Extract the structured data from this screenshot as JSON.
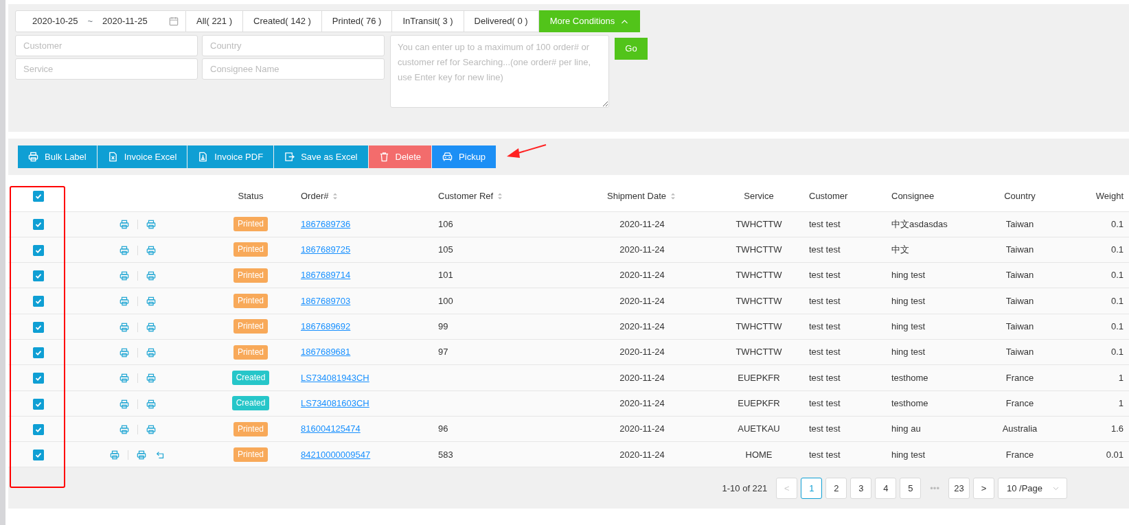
{
  "filters": {
    "date_from": "2020-10-25",
    "date_separator": "~",
    "date_to": "2020-11-25",
    "status_tabs": [
      {
        "label": "All( 221 )",
        "selected": false
      },
      {
        "label": "Created( 142 )",
        "selected": false
      },
      {
        "label": "Printed( 76 )",
        "selected": false
      },
      {
        "label": "InTransit( 3 )",
        "selected": false
      },
      {
        "label": "Delivered( 0 )",
        "selected": false
      }
    ],
    "more_conditions": {
      "label": "More Conditions",
      "expanded": true
    },
    "fields": [
      {
        "placeholder": "Customer"
      },
      {
        "placeholder": "Country"
      },
      {
        "placeholder": "Service"
      },
      {
        "placeholder": "Consignee Name"
      }
    ],
    "search_box": {
      "placeholder": "You can enter up to a maximum of 100 order# or customer ref for Searching...(one order# per line, use Enter key for new line)"
    },
    "go_button": "Go"
  },
  "toolbar": [
    {
      "label": "Bulk Label",
      "kind": "print"
    },
    {
      "label": "Invoice Excel",
      "kind": "excel"
    },
    {
      "label": "Invoice PDF",
      "kind": "pdf"
    },
    {
      "label": "Save as Excel",
      "kind": "export"
    },
    {
      "label": "Delete",
      "kind": "delete"
    },
    {
      "label": "Pickup",
      "kind": "pickup"
    }
  ],
  "table": {
    "select_all": {
      "checked": true
    },
    "columns": [
      {
        "label": "Status",
        "sortable": false
      },
      {
        "label": "Order#",
        "sortable": true
      },
      {
        "label": "Customer Ref",
        "sortable": true
      },
      {
        "label": "Shipment Date",
        "sortable": true
      },
      {
        "label": "Service",
        "sortable": false
      },
      {
        "label": "Customer",
        "sortable": false
      },
      {
        "label": "Consignee",
        "sortable": false
      },
      {
        "label": "Country",
        "sortable": false
      },
      {
        "label": "Weight",
        "sortable": false
      }
    ],
    "rows": [
      {
        "checked": true,
        "returnable": false,
        "status": "Printed",
        "color": "#f8a959",
        "order": "1867689736",
        "ref": "106",
        "date": "2020-11-24",
        "service": "TWHCTTW",
        "customer": "test test",
        "consignee": "中文asdasdas",
        "country": "Taiwan",
        "weight": "0.1"
      },
      {
        "checked": true,
        "returnable": false,
        "status": "Printed",
        "color": "#f8a959",
        "order": "1867689725",
        "ref": "105",
        "date": "2020-11-24",
        "service": "TWHCTTW",
        "customer": "test test",
        "consignee": "中文",
        "country": "Taiwan",
        "weight": "0.1"
      },
      {
        "checked": true,
        "returnable": false,
        "status": "Printed",
        "color": "#f8a959",
        "order": "1867689714",
        "ref": "101",
        "date": "2020-11-24",
        "service": "TWHCTTW",
        "customer": "test test",
        "consignee": "hing test",
        "country": "Taiwan",
        "weight": "0.1"
      },
      {
        "checked": true,
        "returnable": false,
        "status": "Printed",
        "color": "#f8a959",
        "order": "1867689703",
        "ref": "100",
        "date": "2020-11-24",
        "service": "TWHCTTW",
        "customer": "test test",
        "consignee": "hing test",
        "country": "Taiwan",
        "weight": "0.1"
      },
      {
        "checked": true,
        "returnable": false,
        "status": "Printed",
        "color": "#f8a959",
        "order": "1867689692",
        "ref": "99",
        "date": "2020-11-24",
        "service": "TWHCTTW",
        "customer": "test test",
        "consignee": "hing test",
        "country": "Taiwan",
        "weight": "0.1"
      },
      {
        "checked": true,
        "returnable": false,
        "status": "Printed",
        "color": "#f8a959",
        "order": "1867689681",
        "ref": "97",
        "date": "2020-11-24",
        "service": "TWHCTTW",
        "customer": "test test",
        "consignee": "hing test",
        "country": "Taiwan",
        "weight": "0.1"
      },
      {
        "checked": true,
        "returnable": false,
        "status": "Created",
        "color": "#26c6c9",
        "order": "LS734081943CH",
        "date": "2020-11-24",
        "service": "EUEPKFR",
        "customer": "test test",
        "consignee": "testhome",
        "country": "France",
        "weight": "1"
      },
      {
        "checked": true,
        "returnable": false,
        "status": "Created",
        "color": "#26c6c9",
        "order": "LS734081603CH",
        "date": "2020-11-24",
        "service": "EUEPKFR",
        "customer": "test test",
        "consignee": "testhome",
        "country": "France",
        "weight": "1"
      },
      {
        "checked": true,
        "returnable": false,
        "status": "Printed",
        "color": "#f8a959",
        "order": "816004125474",
        "ref": "96",
        "date": "2020-11-24",
        "service": "AUETKAU",
        "customer": "test test",
        "consignee": "hing au",
        "country": "Australia",
        "weight": "1.6"
      },
      {
        "checked": true,
        "returnable": true,
        "status": "Printed",
        "color": "#f8a959",
        "order": "84210000009547",
        "ref": "583",
        "date": "2020-11-24",
        "service": "HOME",
        "customer": "test test",
        "consignee": "hing test",
        "country": "France",
        "weight": "0.01"
      }
    ]
  },
  "pagination": {
    "summary": "1-10 of 221",
    "prev": {
      "label": "<",
      "disabled": true
    },
    "pages": [
      {
        "label": "1",
        "selected": true
      },
      {
        "label": "2",
        "selected": false
      },
      {
        "label": "3",
        "selected": false
      },
      {
        "label": "4",
        "selected": false
      },
      {
        "label": "5",
        "selected": false
      },
      {
        "label": "•••",
        "kind": "ellipsis"
      },
      {
        "label": "23",
        "selected": false
      }
    ],
    "next": {
      "label": ">",
      "disabled": false
    },
    "page_size": "10 /Page"
  }
}
